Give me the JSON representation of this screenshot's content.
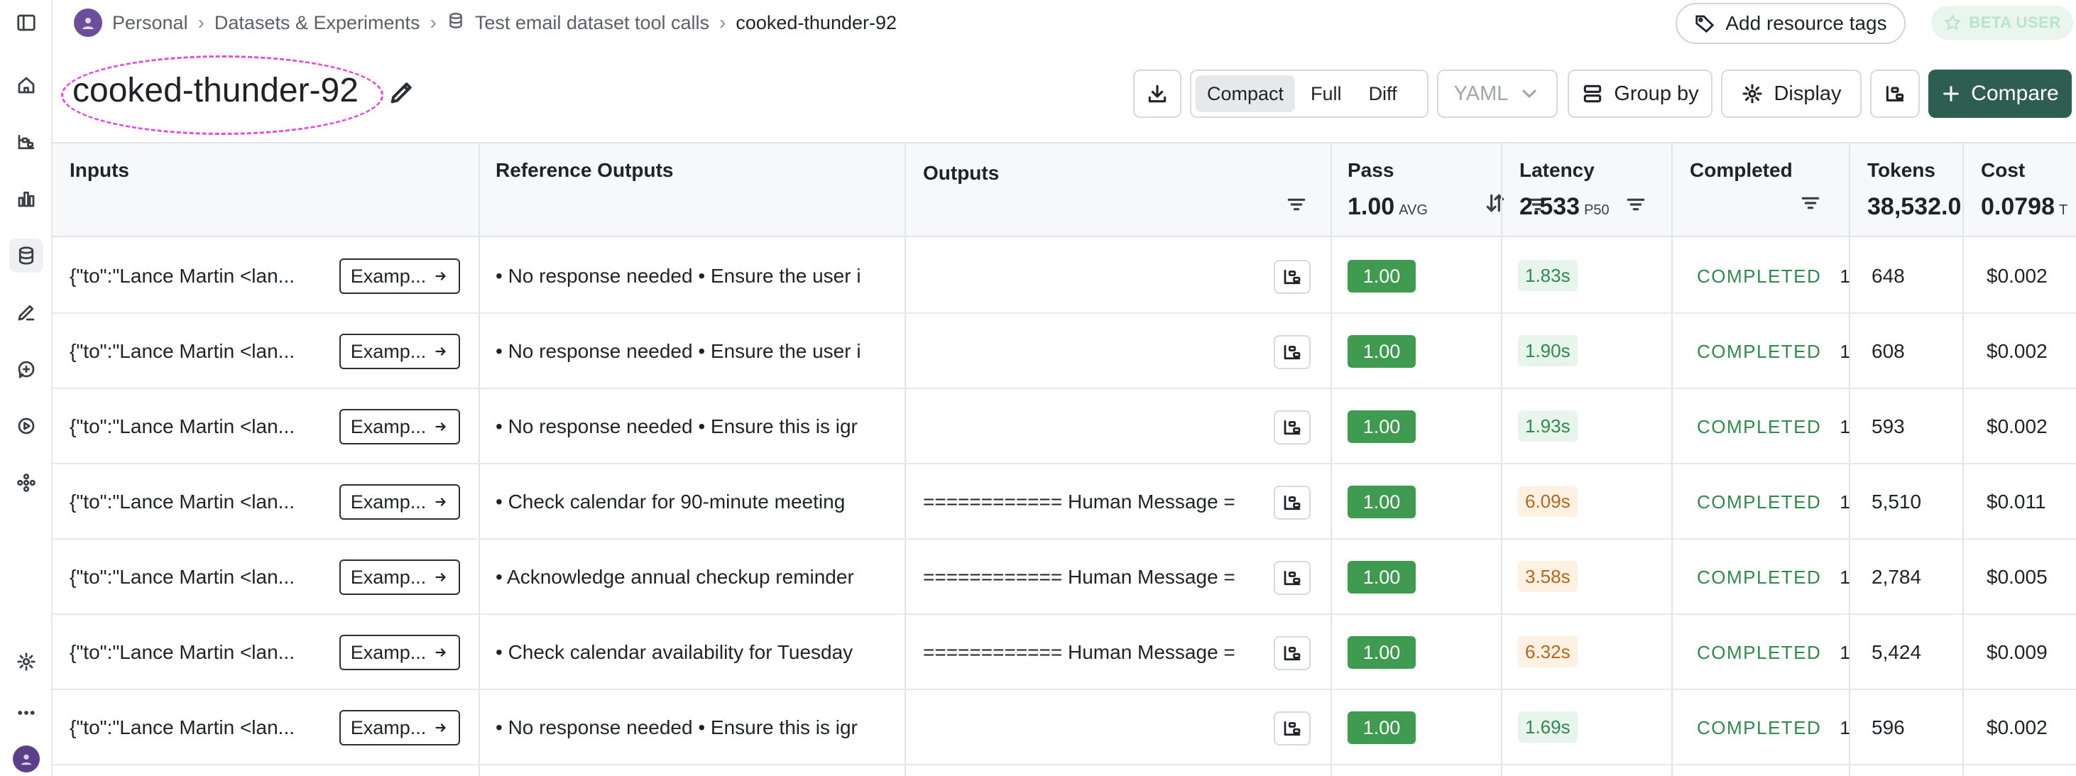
{
  "breadcrumb": {
    "items": [
      "Personal",
      "Datasets & Experiments",
      "Test email dataset tool calls",
      "cooked-thunder-92"
    ]
  },
  "header": {
    "add_tags_label": "Add resource tags",
    "beta_label": "BETA USER",
    "title": "cooked-thunder-92"
  },
  "toolbar": {
    "view_modes": [
      "Compact",
      "Full",
      "Diff"
    ],
    "selected_view": "Compact",
    "format": "YAML",
    "group_by_label": "Group by",
    "display_label": "Display",
    "compare_label": "Compare"
  },
  "columns": {
    "inputs": "Inputs",
    "reference": "Reference Outputs",
    "outputs": "Outputs",
    "pass": "Pass",
    "pass_value": "1.00",
    "pass_unit": "AVG",
    "latency": "Latency",
    "latency_value": "2.533",
    "latency_unit": "P50",
    "completed": "Completed",
    "tokens": "Tokens",
    "tokens_value": "38,532.0",
    "cost": "Cost",
    "cost_value": "0.0798",
    "cost_unit": "T"
  },
  "example_label": "Examp...",
  "rows": [
    {
      "input": "{\"to\":\"Lance Martin <lan...",
      "reference": "• No response needed • Ensure the user i",
      "output": "",
      "pass": "1.00",
      "latency": "1.83s",
      "latency_level": "fast",
      "status": "COMPLETED",
      "count": "1",
      "tokens": "648",
      "cost": "$0.002"
    },
    {
      "input": "{\"to\":\"Lance Martin <lan...",
      "reference": "• No response needed • Ensure the user i",
      "output": "",
      "pass": "1.00",
      "latency": "1.90s",
      "latency_level": "fast",
      "status": "COMPLETED",
      "count": "1",
      "tokens": "608",
      "cost": "$0.002"
    },
    {
      "input": "{\"to\":\"Lance Martin <lan...",
      "reference": "• No response needed • Ensure this is igr",
      "output": "",
      "pass": "1.00",
      "latency": "1.93s",
      "latency_level": "fast",
      "status": "COMPLETED",
      "count": "1",
      "tokens": "593",
      "cost": "$0.002"
    },
    {
      "input": "{\"to\":\"Lance Martin <lan...",
      "reference": "• Check calendar for 90-minute meeting",
      "output": "============ Human Message =",
      "pass": "1.00",
      "latency": "6.09s",
      "latency_level": "slow",
      "status": "COMPLETED",
      "count": "1",
      "tokens": "5,510",
      "cost": "$0.011"
    },
    {
      "input": "{\"to\":\"Lance Martin <lan...",
      "reference": "• Acknowledge annual checkup reminder",
      "output": "============ Human Message =",
      "pass": "1.00",
      "latency": "3.58s",
      "latency_level": "slow",
      "status": "COMPLETED",
      "count": "1",
      "tokens": "2,784",
      "cost": "$0.005"
    },
    {
      "input": "{\"to\":\"Lance Martin <lan...",
      "reference": "• Check calendar availability for Tuesday",
      "output": "============ Human Message =",
      "pass": "1.00",
      "latency": "6.32s",
      "latency_level": "slow",
      "status": "COMPLETED",
      "count": "1",
      "tokens": "5,424",
      "cost": "$0.009"
    },
    {
      "input": "{\"to\":\"Lance Martin <lan...",
      "reference": "• No response needed • Ensure this is igr",
      "output": "",
      "pass": "1.00",
      "latency": "1.69s",
      "latency_level": "fast",
      "status": "COMPLETED",
      "count": "1",
      "tokens": "596",
      "cost": "$0.002"
    }
  ],
  "colors": {
    "pass_green": "#3f9b50",
    "compare_button": "#2e5e52",
    "title_highlight": "#e14be0"
  }
}
